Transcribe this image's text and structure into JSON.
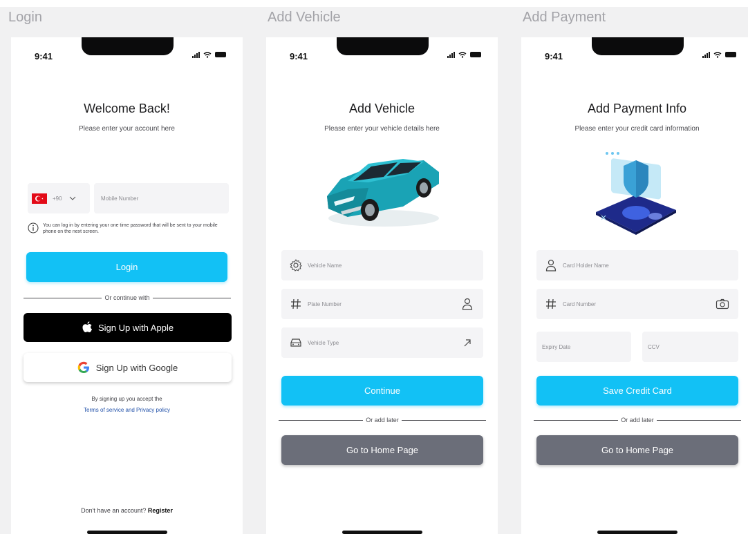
{
  "frames": {
    "login": {
      "title": "Login",
      "status_time": "9:41",
      "heading": "Welcome Back!",
      "subheading": "Please enter your account here",
      "country_code": "+90",
      "mobile_placeholder": "Mobile Number",
      "info_text": "You can log in by entering your one time password that will be sent to your mobile phone on the next screen.",
      "login_label": "Login",
      "divider_text": "Or continue with",
      "apple_label": "Sign Up with Apple",
      "google_label": "Sign Up with Google",
      "terms_line1": "By signing up you accept the",
      "terms_link": "Terms of service and Privacy policy",
      "footer_question": "Don't have an account?",
      "footer_register": "Register"
    },
    "vehicle": {
      "title": "Add Vehicle",
      "status_time": "9:41",
      "heading": "Add Vehicle",
      "subheading": "Please enter your vehicle details here",
      "vehicle_name_placeholder": "Vehicle Name",
      "plate_number_placeholder": "Plate Number",
      "vehicle_type_placeholder": "Vehicle Type",
      "continue_label": "Continue",
      "divider_text": "Or add later",
      "home_label": "Go to Home Page"
    },
    "payment": {
      "title": "Add Payment",
      "status_time": "9:41",
      "heading": "Add Payment Info",
      "subheading": "Please enter your credit card information",
      "card_holder_placeholder": "Card Holder Name",
      "card_number_placeholder": "Card Number",
      "expiry_placeholder": "Expiry Date",
      "ccv_placeholder": "CCV",
      "save_label": "Save Credit Card",
      "divider_text": "Or add later",
      "home_label": "Go to Home Page"
    }
  },
  "colors": {
    "primary": "#12c1f5",
    "secondary_button": "#6b6e79",
    "link": "#1f4fa8",
    "car_body": "#1fa7b8"
  }
}
